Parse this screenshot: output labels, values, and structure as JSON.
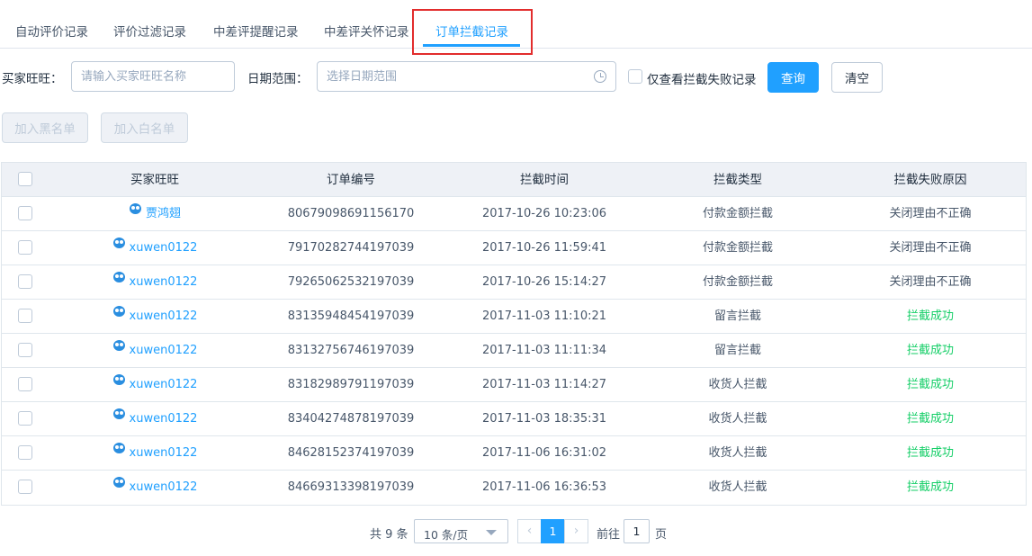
{
  "tabs": [
    {
      "label": "自动评价记录"
    },
    {
      "label": "评价过滤记录"
    },
    {
      "label": "中差评提醒记录"
    },
    {
      "label": "中差评关怀记录"
    },
    {
      "label": "订单拦截记录"
    }
  ],
  "active_tab": "订单拦截记录",
  "filters": {
    "buyer_label": "买家旺旺：",
    "buyer_placeholder": "请输入买家旺旺名称",
    "date_label": "日期范围：",
    "date_placeholder": "选择日期范围",
    "failed_only_label": "仅查看拦截失败记录",
    "query_label": "查询",
    "clear_label": "清空"
  },
  "actions": {
    "blacklist_label": "加入黑名单",
    "whitelist_label": "加入白名单"
  },
  "table": {
    "columns": [
      "买家旺旺",
      "订单编号",
      "拦截时间",
      "拦截类型",
      "拦截失败原因"
    ],
    "rows": [
      {
        "buyer": "贾鸿翅",
        "order": "80679098691156170",
        "time": "2017-10-26 10:23:06",
        "type": "付款金额拦截",
        "reason": "关闭理由不正确",
        "status": "fail"
      },
      {
        "buyer": "xuwen0122",
        "order": "79170282744197039",
        "time": "2017-10-26 11:59:41",
        "type": "付款金额拦截",
        "reason": "关闭理由不正确",
        "status": "fail"
      },
      {
        "buyer": "xuwen0122",
        "order": "79265062532197039",
        "time": "2017-10-26 15:14:27",
        "type": "付款金额拦截",
        "reason": "关闭理由不正确",
        "status": "fail"
      },
      {
        "buyer": "xuwen0122",
        "order": "83135948454197039",
        "time": "2017-11-03 11:10:21",
        "type": "留言拦截",
        "reason": "拦截成功",
        "status": "success"
      },
      {
        "buyer": "xuwen0122",
        "order": "83132756746197039",
        "time": "2017-11-03 11:11:34",
        "type": "留言拦截",
        "reason": "拦截成功",
        "status": "success"
      },
      {
        "buyer": "xuwen0122",
        "order": "83182989791197039",
        "time": "2017-11-03 11:14:27",
        "type": "收货人拦截",
        "reason": "拦截成功",
        "status": "success"
      },
      {
        "buyer": "xuwen0122",
        "order": "83404274878197039",
        "time": "2017-11-03 18:35:31",
        "type": "收货人拦截",
        "reason": "拦截成功",
        "status": "success"
      },
      {
        "buyer": "xuwen0122",
        "order": "84628152374197039",
        "time": "2017-11-06 16:31:02",
        "type": "收货人拦截",
        "reason": "拦截成功",
        "status": "success"
      },
      {
        "buyer": "xuwen0122",
        "order": "84669313398197039",
        "time": "2017-11-06 16:36:53",
        "type": "收货人拦截",
        "reason": "拦截成功",
        "status": "success"
      }
    ]
  },
  "pagination": {
    "total_text": "共 9 条",
    "page_size": "10 条/页",
    "prev_icon": "‹",
    "next_icon": "›",
    "current_page": "1",
    "goto_label": "前往",
    "goto_value": "1",
    "page_suffix": "页"
  },
  "colors": {
    "primary": "#20a0ff",
    "success": "#13ce66",
    "highlight_border": "#e22d2d"
  }
}
